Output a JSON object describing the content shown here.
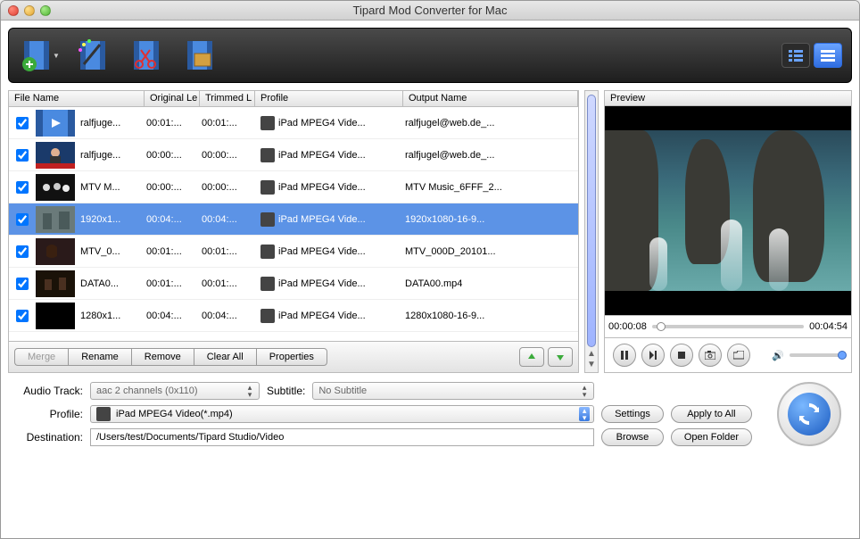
{
  "window_title": "Tipard Mod Converter for Mac",
  "columns": {
    "filename": "File Name",
    "original": "Original Le",
    "trimmed": "Trimmed L",
    "profile": "Profile",
    "output": "Output Name"
  },
  "rows": [
    {
      "checked": true,
      "name": "ralfjuge...",
      "orig": "00:01:...",
      "trim": "00:01:...",
      "profile": "iPad MPEG4 Vide...",
      "output": "ralfjugel@web.de_...",
      "sel": false,
      "thumb": "film"
    },
    {
      "checked": true,
      "name": "ralfjuge...",
      "orig": "00:00:...",
      "trim": "00:00:...",
      "profile": "iPad MPEG4 Vide...",
      "output": "ralfjugel@web.de_...",
      "sel": false,
      "thumb": "news"
    },
    {
      "checked": true,
      "name": "MTV M...",
      "orig": "00:00:...",
      "trim": "00:00:...",
      "profile": "iPad MPEG4 Vide...",
      "output": "MTV Music_6FFF_2...",
      "sel": false,
      "thumb": "bw"
    },
    {
      "checked": true,
      "name": "1920x1...",
      "orig": "00:04:...",
      "trim": "00:04:...",
      "profile": "iPad MPEG4 Vide...",
      "output": "1920x1080-16-9...",
      "sel": true,
      "thumb": "gray"
    },
    {
      "checked": true,
      "name": "MTV_0...",
      "orig": "00:01:...",
      "trim": "00:01:...",
      "profile": "iPad MPEG4 Vide...",
      "output": "MTV_000D_20101...",
      "sel": false,
      "thumb": "woman"
    },
    {
      "checked": true,
      "name": "DATA0...",
      "orig": "00:01:...",
      "trim": "00:01:...",
      "profile": "iPad MPEG4 Vide...",
      "output": "DATA00.mp4",
      "sel": false,
      "thumb": "dark"
    },
    {
      "checked": true,
      "name": "1280x1...",
      "orig": "00:04:...",
      "trim": "00:04:...",
      "profile": "iPad MPEG4 Vide...",
      "output": "1280x1080-16-9...",
      "sel": false,
      "thumb": "black"
    }
  ],
  "list_buttons": {
    "merge": "Merge",
    "rename": "Rename",
    "remove": "Remove",
    "clearall": "Clear All",
    "properties": "Properties"
  },
  "preview": {
    "label": "Preview",
    "current": "00:00:08",
    "total": "00:04:54"
  },
  "form": {
    "audio_label": "Audio Track:",
    "audio_value": "aac 2 channels (0x110)",
    "subtitle_label": "Subtitle:",
    "subtitle_value": "No Subtitle",
    "profile_label": "Profile:",
    "profile_value": "iPad MPEG4 Video(*.mp4)",
    "settings": "Settings",
    "applyall": "Apply to All",
    "dest_label": "Destination:",
    "dest_value": "/Users/test/Documents/Tipard Studio/Video",
    "browse": "Browse",
    "openfolder": "Open Folder"
  }
}
